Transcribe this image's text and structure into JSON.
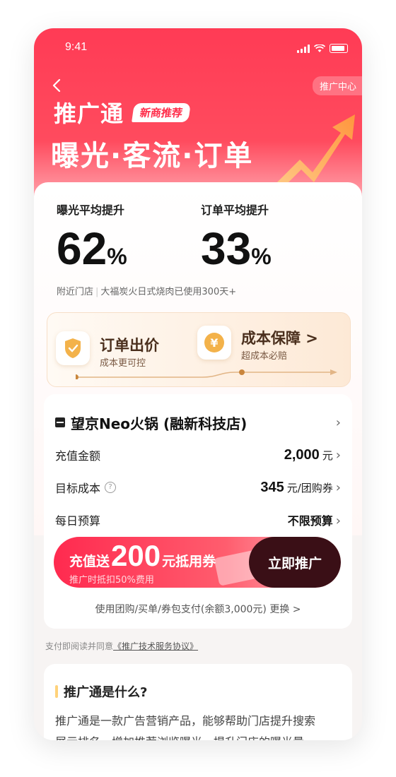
{
  "status_bar": {
    "time": "9:41"
  },
  "header": {
    "back_icon": "back-arrow-icon",
    "promo_center_label": "推广中心",
    "brand_title": "推广通",
    "badge": "新商推荐",
    "slogan": "曝光·客流·订单"
  },
  "metrics": [
    {
      "label": "曝光平均提升",
      "value": "62",
      "unit": "%"
    },
    {
      "label": "订单平均提升",
      "value": "33",
      "unit": "%"
    }
  ],
  "nearby": {
    "prefix": "附近门店",
    "detail": "大福炭火日式烧肉已使用300天+"
  },
  "bid_options": [
    {
      "title": "订单出价",
      "subtitle": "成本更可控",
      "icon": "shield-icon"
    },
    {
      "title": "成本保障 >",
      "subtitle": "超成本必赔",
      "icon": "yen-coin-icon"
    }
  ],
  "store": {
    "name": "望京Neo火锅 (融新科技店)"
  },
  "fields": {
    "recharge": {
      "label": "充值金额",
      "value": "2,000",
      "unit": "元"
    },
    "target_cost": {
      "label": "目标成本",
      "value": "345",
      "unit": "元/团购券"
    },
    "daily_budget": {
      "label": "每日预算",
      "value": "不限预算"
    }
  },
  "cta": {
    "prefix": "充值送",
    "amount": "200",
    "suffix": "元抵用券",
    "sub": "推广时抵扣50%费用",
    "button": "立即推广"
  },
  "payment_note": "使用团购/买单/券包支付(余额3,000元) 更换 >",
  "agreement": {
    "prefix": "支付即阅读并同意",
    "link": "《推广技术服务协议》"
  },
  "faq": {
    "title": "推广通是什么?",
    "body_line1": "推广通是一款广告营销产品，能够帮助门店提升搜索",
    "body_line2": "展示排名、增加推荐浏览曝光、提升门店的曝光量"
  },
  "colors": {
    "brand_red": "#ff3b55",
    "cta_dark": "#3a0f16",
    "gold": "#c9863d"
  }
}
